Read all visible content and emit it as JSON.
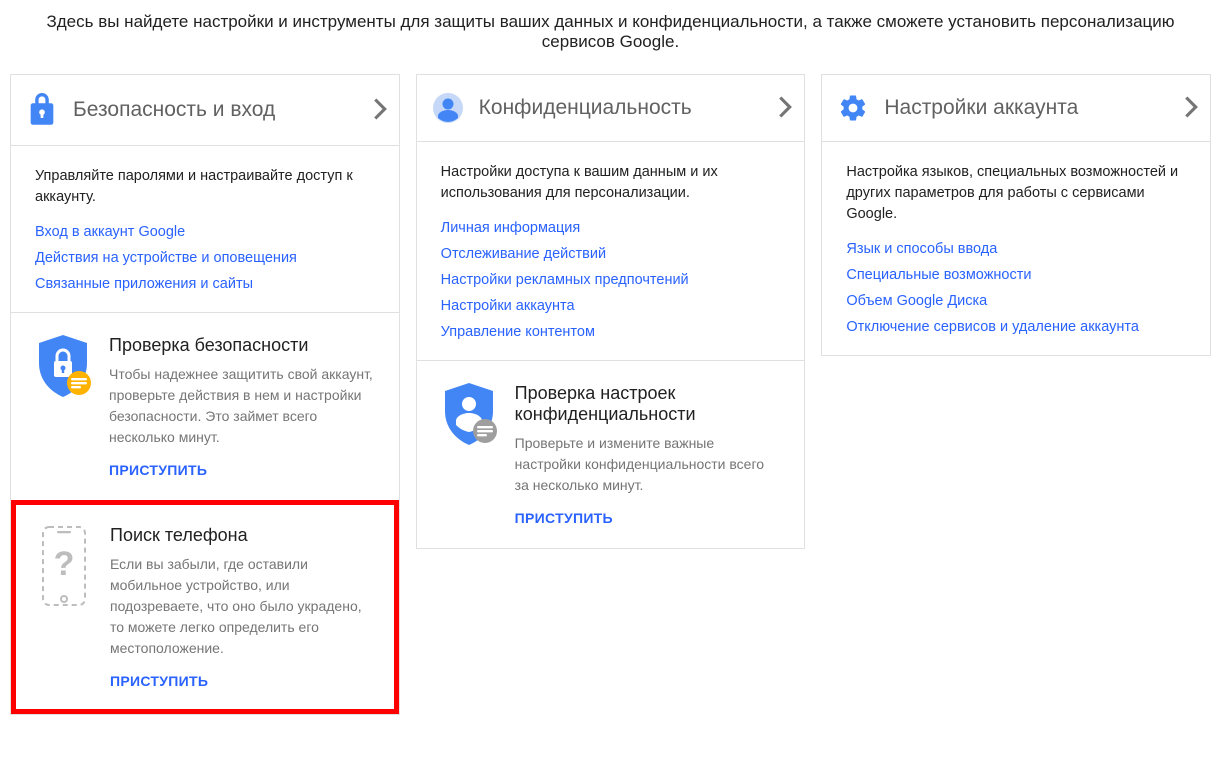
{
  "intro": "Здесь вы найдете настройки и инструменты для защиты ваших данных и конфиденциальности, а также сможете установить персонализацию сервисов Google.",
  "security": {
    "title": "Безопасность и вход",
    "desc": "Управляйте паролями и настраивайте доступ к аккаунту.",
    "links": {
      "l0": "Вход в аккаунт Google",
      "l1": "Действия на устройстве и оповещения",
      "l2": "Связанные приложения и сайты"
    },
    "checkup": {
      "title": "Проверка безопасности",
      "desc": "Чтобы надежнее защитить свой аккаунт, проверьте действия в нем и настройки безопасности. Это займет всего несколько минут.",
      "action": "ПРИСТУПИТЬ"
    },
    "findphone": {
      "title": "Поиск телефона",
      "desc": "Если вы забыли, где оставили мобильное устройство, или подозреваете, что оно было украдено, то можете легко определить его местоположение.",
      "action": "ПРИСТУПИТЬ"
    }
  },
  "privacy": {
    "title": "Конфиденциальность",
    "desc": "Настройки доступа к вашим данным и их использования для персонализации.",
    "links": {
      "l0": "Личная информация",
      "l1": "Отслеживание действий",
      "l2": "Настройки рекламных предпочтений",
      "l3": "Настройки аккаунта",
      "l4": "Управление контентом"
    },
    "checkup": {
      "title": "Проверка настроек конфиденциальности",
      "desc": "Проверьте и измените важные настройки конфиденциальности всего за несколько минут.",
      "action": "ПРИСТУПИТЬ"
    }
  },
  "account": {
    "title": "Настройки аккаунта",
    "desc": "Настройка языков, специальных возможностей и других параметров для работы с сервисами Google.",
    "links": {
      "l0": "Язык и способы ввода",
      "l1": "Специальные возможности",
      "l2": "Объем Google Диска",
      "l3": "Отключение сервисов и удаление аккаунта"
    }
  }
}
